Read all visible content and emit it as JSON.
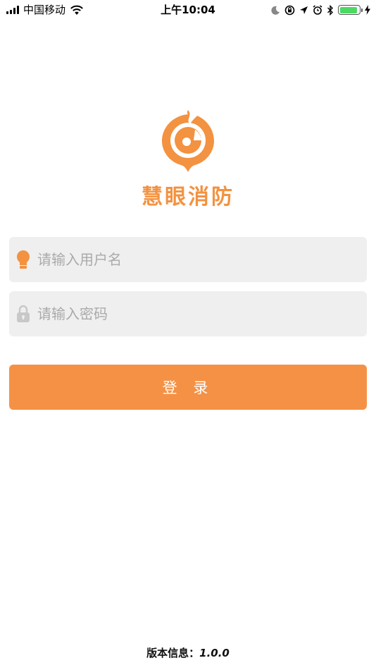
{
  "status_bar": {
    "carrier": "中国移动",
    "time": "上午10:04",
    "battery_level": 0.9
  },
  "app": {
    "name": "慧眼消防",
    "brand_color": "#f39240"
  },
  "login_form": {
    "username_placeholder": "请输入用户名",
    "password_placeholder": "请输入密码",
    "login_label": "登 录"
  },
  "footer": {
    "version_label": "版本信息：",
    "version_number": "1.0.0"
  },
  "icons": {
    "username": "user-pin-icon",
    "password": "lock-icon"
  }
}
